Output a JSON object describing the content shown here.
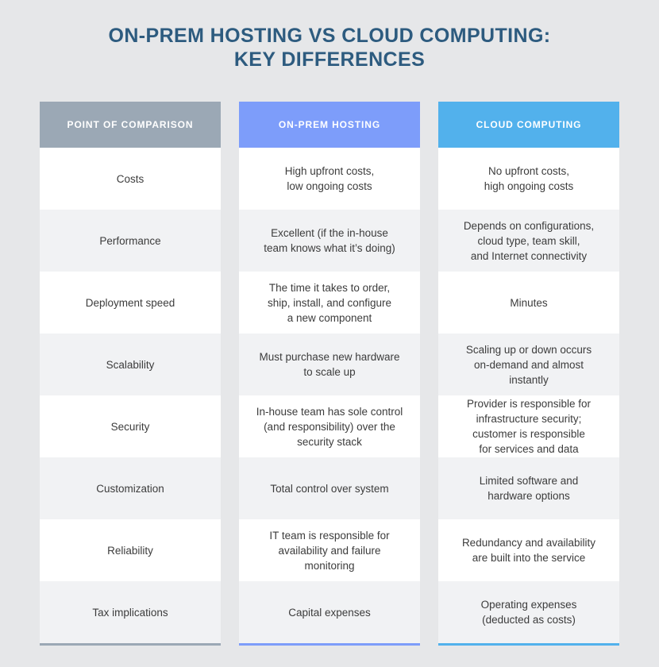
{
  "title": {
    "line1": "On-Prem Hosting vs Cloud Computing:",
    "line2": "Key Differences",
    "color": "#2d5b7f"
  },
  "colors": {
    "background": "#e6e7e9",
    "row_white": "#ffffff",
    "row_shaded": "#f1f2f4",
    "body_text": "#3c3c3c",
    "header_text": "#ffffff",
    "col1_header": "#9ba8b5",
    "col2_header": "#7d9dfa",
    "col3_header": "#52b1ec"
  },
  "table": {
    "columns": [
      {
        "label": "Point of Comparison",
        "header_color": "#9ba8b5",
        "accent_color": "#9ba8b5"
      },
      {
        "label": "On-Prem Hosting",
        "header_color": "#7d9dfa",
        "accent_color": "#7d9dfa"
      },
      {
        "label": "Cloud Computing",
        "header_color": "#52b1ec",
        "accent_color": "#52b1ec"
      }
    ],
    "rows": [
      {
        "point": "Costs",
        "onprem": [
          "High upfront costs,",
          "low ongoing costs"
        ],
        "cloud": [
          "No upfront costs,",
          "high ongoing costs"
        ]
      },
      {
        "point": "Performance",
        "onprem": [
          "Excellent (if the in-house",
          "team knows what it’s doing)"
        ],
        "cloud": [
          "Depends on configurations,",
          "cloud type, team skill,",
          "and Internet connectivity"
        ]
      },
      {
        "point": "Deployment speed",
        "onprem": [
          "The time it takes to order,",
          "ship, install, and configure",
          "a new component"
        ],
        "cloud": [
          "Minutes"
        ]
      },
      {
        "point": "Scalability",
        "onprem": [
          "Must purchase new hardware",
          "to scale up"
        ],
        "cloud": [
          "Scaling up or down occurs",
          "on-demand and almost",
          "instantly"
        ]
      },
      {
        "point": "Security",
        "onprem": [
          "In-house team has sole control",
          "(and responsibility) over the",
          "security stack"
        ],
        "cloud": [
          "Provider is responsible for",
          "infrastructure security;",
          "customer is responsible",
          "for services and data"
        ]
      },
      {
        "point": "Customization",
        "onprem": [
          "Total control over system"
        ],
        "cloud": [
          "Limited software and",
          "hardware options"
        ]
      },
      {
        "point": "Reliability",
        "onprem": [
          "IT team is responsible for",
          "availability and failure",
          "monitoring"
        ],
        "cloud": [
          "Redundancy and availability",
          "are built into the service"
        ]
      },
      {
        "point": "Tax implications",
        "onprem": [
          "Capital expenses"
        ],
        "cloud": [
          "Operating expenses",
          "(deducted as costs)"
        ]
      }
    ]
  }
}
